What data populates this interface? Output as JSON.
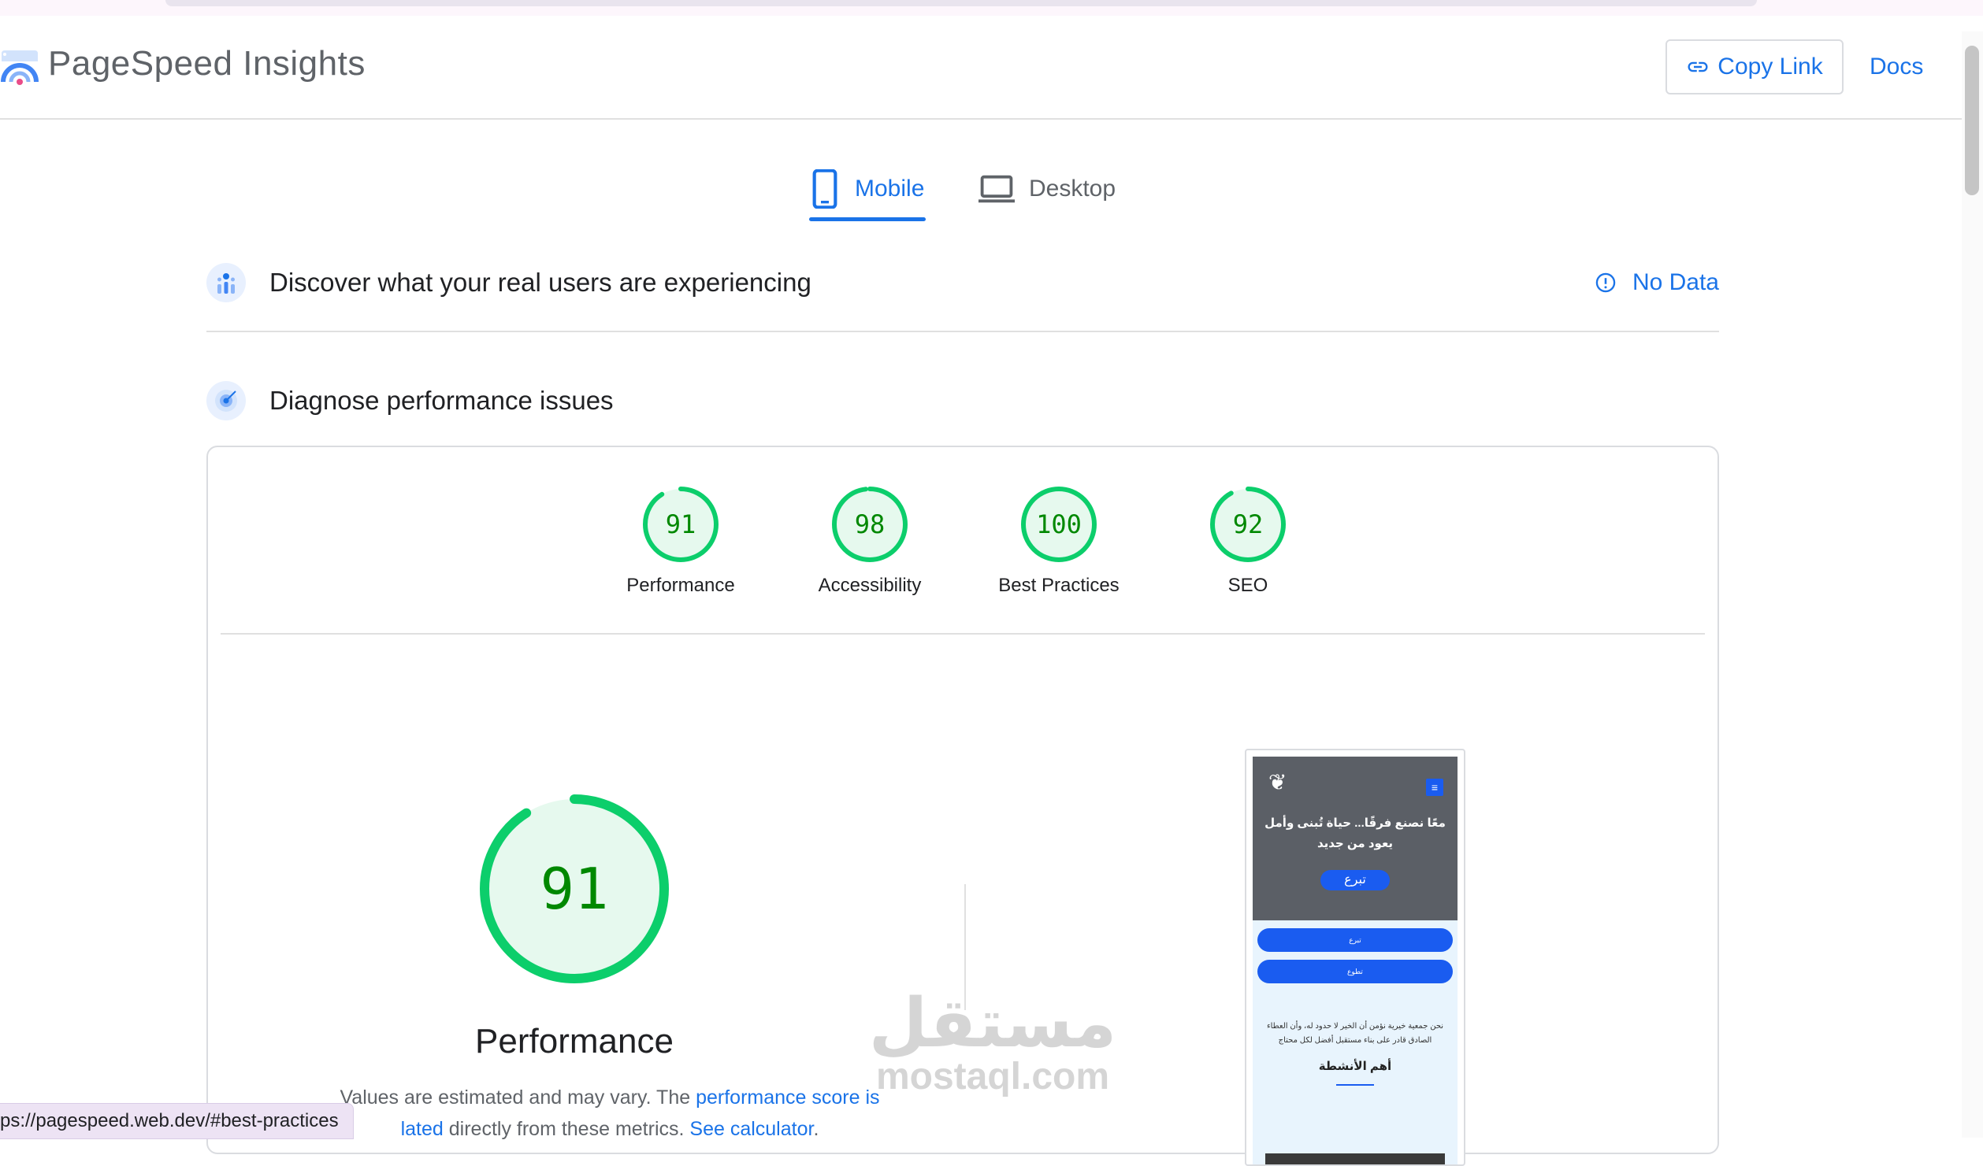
{
  "header": {
    "brand": "PageSpeed Insights",
    "copy_link": "Copy Link",
    "docs": "Docs"
  },
  "tabs": [
    {
      "label": "Mobile",
      "icon": "smartphone-icon",
      "selected": true
    },
    {
      "label": "Desktop",
      "icon": "laptop-icon",
      "selected": false
    }
  ],
  "real_users": {
    "title": "Discover what your real users are experiencing",
    "status": "No Data"
  },
  "diagnose": {
    "title": "Diagnose performance issues"
  },
  "scores": [
    {
      "label": "Performance",
      "score": "91",
      "value": 91
    },
    {
      "label": "Accessibility",
      "score": "98",
      "value": 98
    },
    {
      "label": "Best Practices",
      "score": "100",
      "value": 100
    },
    {
      "label": "SEO",
      "score": "92",
      "value": 92
    }
  ],
  "performance": {
    "score": "91",
    "value": 91,
    "label": "Performance",
    "note_start": "Values are estimated and may vary. The ",
    "note_link1": "performance score is",
    "note_link2": "lated",
    "note_mid": " directly from these metrics. ",
    "note_link3": "See calculator",
    "note_end": "."
  },
  "preview": {
    "headline": "معًا نصنع فرقًا... حياة تُبنى وأمل يعود من جديد",
    "donate": "تبرع",
    "button1": "تبرع",
    "button2": "تطوع",
    "text": "نحن جمعية خيرية نؤمن أن الخير لا حدود له، وأن العطاء الصادق قادر على بناء مستقبل أفضل لكل محتاج",
    "heading": "أهم الأنشطة",
    "menu_icon": "≡"
  },
  "watermark": {
    "arabic": "مستقل",
    "latin": "mostaql.com"
  },
  "status_bar": {
    "url": "ps://pagespeed.web.dev/#best-practices"
  },
  "colors": {
    "good": "#0cce6b",
    "good_text": "#008800",
    "accent": "#1a73e8"
  }
}
